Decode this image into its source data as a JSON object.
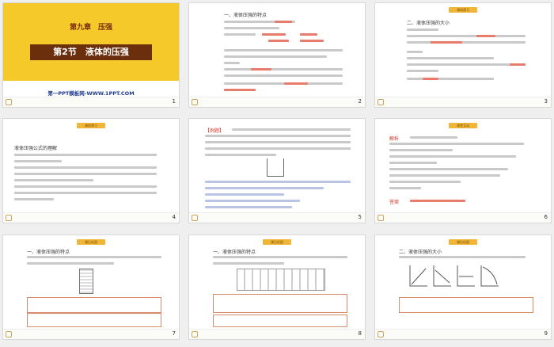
{
  "slides": [
    {
      "number": "1",
      "chapter": "第九章　压强",
      "section": "第2节　液体的压强",
      "brand": "第一PPT模板网-WWW.1PPT.COM"
    },
    {
      "number": "2",
      "heading": "一、液体压强的特点"
    },
    {
      "number": "3",
      "tag": "课前预习",
      "heading": "二、液体压强的大小"
    },
    {
      "number": "4",
      "tag": "课前预习",
      "heading": "液体压强公式的理解"
    },
    {
      "number": "5",
      "tag": "课堂互动",
      "heading": "【例题】"
    },
    {
      "number": "6",
      "tag": "课堂互动",
      "heading": "解析",
      "answer": "答案"
    },
    {
      "number": "7",
      "tag": "课后巩固",
      "heading": "一、液体压强的特点"
    },
    {
      "number": "8",
      "tag": "课后巩固",
      "heading": "一、液体压强的特点"
    },
    {
      "number": "9",
      "tag": "课后巩固",
      "heading": "二、液体压强的大小"
    }
  ],
  "colors": {
    "accent": "#f6c92a",
    "brown": "#6c2f0d",
    "red": "#d43a2a",
    "tag": "#f0b63a"
  },
  "icons": {
    "footer": "home-icon"
  }
}
